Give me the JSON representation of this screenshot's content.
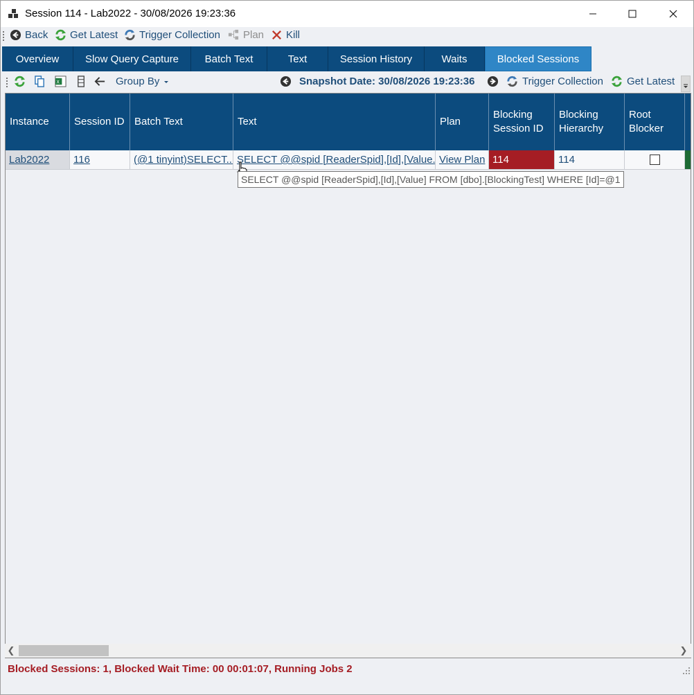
{
  "window": {
    "title": "Session 114 - Lab2022 - 30/08/2026 19:23:36"
  },
  "commandbar": {
    "back": "Back",
    "get_latest": "Get Latest",
    "trigger_collection": "Trigger Collection",
    "plan": "Plan",
    "kill": "Kill"
  },
  "tabs": [
    {
      "label": "Overview"
    },
    {
      "label": "Slow Query Capture"
    },
    {
      "label": "Batch Text"
    },
    {
      "label": "Text"
    },
    {
      "label": "Session History"
    },
    {
      "label": "Waits"
    },
    {
      "label": "Blocked Sessions",
      "active": true
    }
  ],
  "subbar": {
    "group_by": "Group By",
    "snapshot_date": "Snapshot Date: 30/08/2026 19:23:36",
    "trigger_collection": "Trigger Collection",
    "get_latest": "Get Latest"
  },
  "grid": {
    "columns": [
      {
        "label": "Instance"
      },
      {
        "label": "Session ID"
      },
      {
        "label": "Batch Text"
      },
      {
        "label": "Text"
      },
      {
        "label": "Plan"
      },
      {
        "label": "Blocking Session ID"
      },
      {
        "label": "Blocking Hierarchy"
      },
      {
        "label": "Root Blocker"
      }
    ],
    "rows": [
      {
        "instance": "Lab2022",
        "session_id": "116",
        "batch_text": "(@1 tinyint)SELECT...",
        "text": "SELECT @@spid [ReaderSpid],[Id],[Value...",
        "plan": "View Plan",
        "blocking_session_id": "114",
        "blocking_hierarchy": "114",
        "root_blocker": false
      }
    ]
  },
  "tooltip": {
    "text": "SELECT @@spid [ReaderSpid],[Id],[Value] FROM [dbo].[BlockingTest] WHERE [Id]=@1"
  },
  "status": {
    "text": "Blocked Sessions: 1, Blocked Wait Time: 00 00:01:07, Running Jobs 2"
  },
  "colors": {
    "header_blue": "#0c4b7e",
    "active_tab": "#2f86c6",
    "blocking_red": "#a51d24",
    "link_blue": "#1f4e79"
  }
}
